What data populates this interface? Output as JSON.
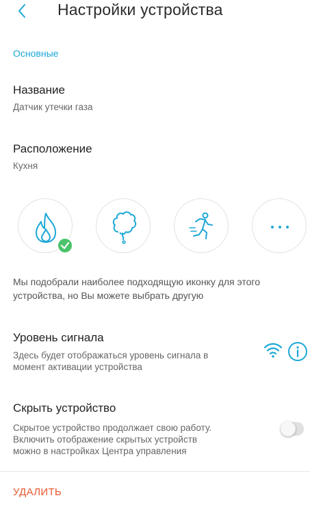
{
  "header": {
    "title": "Настройки устройства",
    "back_icon": "chevron-left-icon"
  },
  "section": {
    "label": "Основные"
  },
  "name_field": {
    "title": "Название",
    "value": "Датчик утечки газа"
  },
  "location_field": {
    "title": "Расположение",
    "value": "Кухня"
  },
  "icons": {
    "items": [
      "flame-icon",
      "smoke-icon",
      "running-person-icon",
      "more-dots-icon"
    ],
    "selected": "flame-icon",
    "hint": "Мы подобрали наиболее подходящую иконку для этого устройства, но Вы можете выбрать другую"
  },
  "signal": {
    "title": "Уровень сигнала",
    "description_line1": "Здесь будет отображаться уровень сигнала в",
    "description_line2": "момент активации устройства"
  },
  "hide_device": {
    "title": "Скрыть устройство",
    "description_line1": "Скрытое устройство продолжает свою работу.",
    "description_line2": "Включить отображение скрытых устройств",
    "description_line3": "можно в настройках Центра управления",
    "toggle_on": false
  },
  "footer": {
    "delete_label": "УДАЛИТЬ"
  },
  "colors": {
    "accent": "#1ba7d6",
    "check_green": "#4cc36a",
    "danger": "#e8572d"
  }
}
